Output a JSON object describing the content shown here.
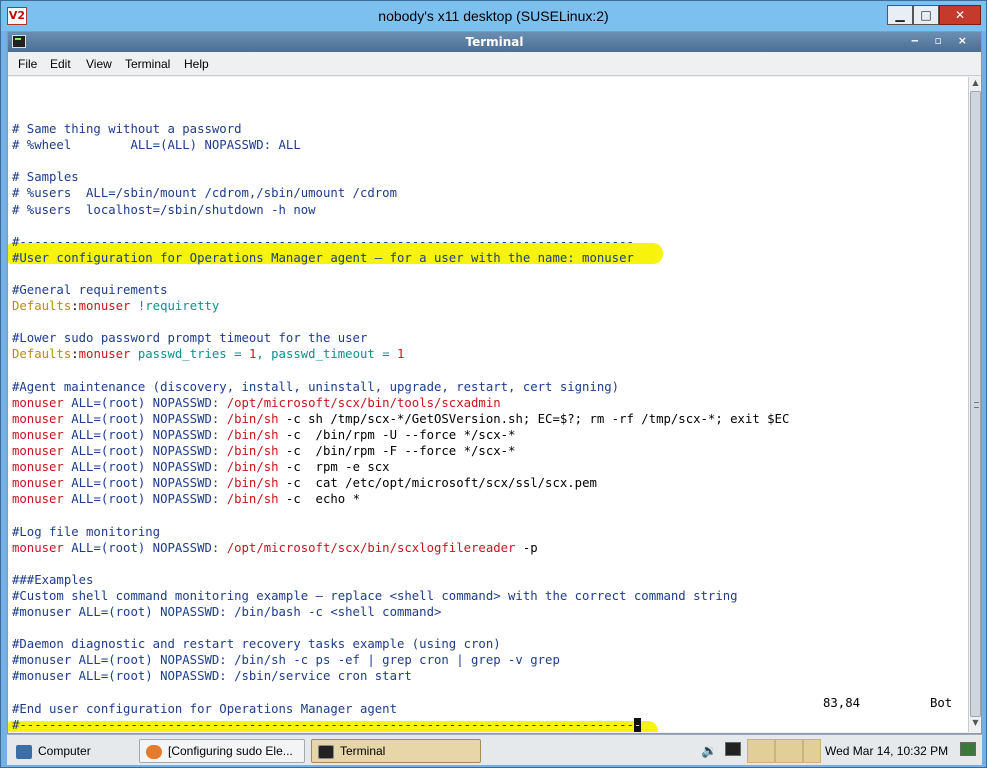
{
  "window": {
    "title": "nobody's x11 desktop (SUSELinux:2)",
    "logo": "V2",
    "minimize": "▁",
    "maximize": "□",
    "close": "✕"
  },
  "terminal": {
    "title": "Terminal",
    "controls": "‒ ▫ ×"
  },
  "menu": [
    "File",
    "Edit",
    "View",
    "Terminal",
    "Help"
  ],
  "colors": {
    "comment": "#1e3c8c",
    "user": "#c8141e",
    "keyword": "#b48c14",
    "value": "#148c8c",
    "number": "#c8141e",
    "path": "#b4148c",
    "plain": "#000000",
    "highlight": "#f7f200"
  },
  "lines": [
    {
      "row": 0,
      "segs": [
        {
          "t": "# Same thing without a password",
          "c": "comment"
        }
      ]
    },
    {
      "row": 1,
      "segs": [
        {
          "t": "# %wheel        ALL=(ALL) NOPASSWD: ALL",
          "c": "comment"
        }
      ]
    },
    {
      "row": 3,
      "segs": [
        {
          "t": "# Samples",
          "c": "comment"
        }
      ]
    },
    {
      "row": 4,
      "segs": [
        {
          "t": "# %users  ALL=/sbin/mount /cdrom,/sbin/umount /cdrom",
          "c": "comment"
        }
      ]
    },
    {
      "row": 5,
      "segs": [
        {
          "t": "# %users  localhost=/sbin/shutdown -h now",
          "c": "comment"
        }
      ]
    },
    {
      "row": 7,
      "segs": [
        {
          "t": "#-----------------------------------------------------------------------------------",
          "c": "comment"
        }
      ]
    },
    {
      "row": 8,
      "segs": [
        {
          "t": "#User configuration for Operations Manager agent – for a user with the name: monuser",
          "c": "comment"
        }
      ]
    },
    {
      "row": 10,
      "segs": [
        {
          "t": "#General requirements",
          "c": "comment"
        }
      ]
    },
    {
      "row": 11,
      "segs": [
        {
          "t": "Defaults",
          "c": "keyword"
        },
        {
          "t": ":",
          "c": "plain"
        },
        {
          "t": "monuser",
          "c": "user"
        },
        {
          "t": " !requiretty",
          "c": "value"
        }
      ]
    },
    {
      "row": 13,
      "segs": [
        {
          "t": "#Lower sudo password prompt timeout for the user",
          "c": "comment"
        }
      ]
    },
    {
      "row": 14,
      "segs": [
        {
          "t": "Defaults",
          "c": "keyword"
        },
        {
          "t": ":",
          "c": "plain"
        },
        {
          "t": "monuser",
          "c": "user"
        },
        {
          "t": " passwd_tries = ",
          "c": "value"
        },
        {
          "t": "1",
          "c": "number"
        },
        {
          "t": ", passwd_timeout = ",
          "c": "value"
        },
        {
          "t": "1",
          "c": "number"
        }
      ]
    },
    {
      "row": 16,
      "segs": [
        {
          "t": "#Agent maintenance (discovery, install, uninstall, upgrade, restart, cert signing)",
          "c": "comment"
        }
      ]
    },
    {
      "row": 17,
      "segs": [
        {
          "t": "monuser",
          "c": "user"
        },
        {
          "t": " ALL=(root) NOPASSWD: ",
          "c": "comment"
        },
        {
          "t": "/opt/microsoft/scx/bin/tools/scxadmin",
          "c": "user"
        }
      ]
    },
    {
      "row": 18,
      "segs": [
        {
          "t": "monuser",
          "c": "user"
        },
        {
          "t": " ALL=(root) NOPASSWD: ",
          "c": "comment"
        },
        {
          "t": "/bin/sh",
          "c": "user"
        },
        {
          "t": " -c sh /tmp/scx-*/GetOSVersion.sh; EC=$?; rm -rf /tmp/scx-*; exit $EC",
          "c": "plain"
        }
      ]
    },
    {
      "row": 19,
      "segs": [
        {
          "t": "monuser",
          "c": "user"
        },
        {
          "t": " ALL=(root) NOPASSWD: ",
          "c": "comment"
        },
        {
          "t": "/bin/sh",
          "c": "user"
        },
        {
          "t": " -c  /bin/rpm -U --force */scx-*",
          "c": "plain"
        }
      ]
    },
    {
      "row": 20,
      "segs": [
        {
          "t": "monuser",
          "c": "user"
        },
        {
          "t": " ALL=(root) NOPASSWD: ",
          "c": "comment"
        },
        {
          "t": "/bin/sh",
          "c": "user"
        },
        {
          "t": " -c  /bin/rpm -F --force */scx-*",
          "c": "plain"
        }
      ]
    },
    {
      "row": 21,
      "segs": [
        {
          "t": "monuser",
          "c": "user"
        },
        {
          "t": " ALL=(root) NOPASSWD: ",
          "c": "comment"
        },
        {
          "t": "/bin/sh",
          "c": "user"
        },
        {
          "t": " -c  rpm -e scx",
          "c": "plain"
        }
      ]
    },
    {
      "row": 22,
      "segs": [
        {
          "t": "monuser",
          "c": "user"
        },
        {
          "t": " ALL=(root) NOPASSWD: ",
          "c": "comment"
        },
        {
          "t": "/bin/sh",
          "c": "user"
        },
        {
          "t": " -c  cat /etc/opt/microsoft/scx/ssl/scx.pem",
          "c": "plain"
        }
      ]
    },
    {
      "row": 23,
      "segs": [
        {
          "t": "monuser",
          "c": "user"
        },
        {
          "t": " ALL=(root) NOPASSWD: ",
          "c": "comment"
        },
        {
          "t": "/bin/sh",
          "c": "user"
        },
        {
          "t": " -c  echo *",
          "c": "plain"
        }
      ]
    },
    {
      "row": 25,
      "segs": [
        {
          "t": "#Log file monitoring",
          "c": "comment"
        }
      ]
    },
    {
      "row": 26,
      "segs": [
        {
          "t": "monuser",
          "c": "user"
        },
        {
          "t": " ALL=(root) NOPASSWD: ",
          "c": "comment"
        },
        {
          "t": "/opt/microsoft/scx/bin/scxlogfilereader",
          "c": "user"
        },
        {
          "t": " -p",
          "c": "plain"
        }
      ]
    },
    {
      "row": 28,
      "segs": [
        {
          "t": "###Examples",
          "c": "comment"
        }
      ]
    },
    {
      "row": 29,
      "segs": [
        {
          "t": "#Custom shell command monitoring example – replace <shell command> with the correct command string",
          "c": "comment"
        }
      ]
    },
    {
      "row": 30,
      "segs": [
        {
          "t": "#monuser ALL=(root) NOPASSWD: /bin/bash -c <shell command>",
          "c": "comment"
        }
      ]
    },
    {
      "row": 32,
      "segs": [
        {
          "t": "#Daemon diagnostic and restart recovery tasks example (using cron)",
          "c": "comment"
        }
      ]
    },
    {
      "row": 33,
      "segs": [
        {
          "t": "#monuser ALL=(root) NOPASSWD: /bin/sh -c ps -ef | grep cron | grep -v grep",
          "c": "comment"
        }
      ]
    },
    {
      "row": 34,
      "segs": [
        {
          "t": "#monuser ALL=(root) NOPASSWD: /sbin/service cron start",
          "c": "comment"
        }
      ]
    },
    {
      "row": 36,
      "segs": [
        {
          "t": "#End user configuration for Operations Manager agent",
          "c": "comment"
        }
      ]
    },
    {
      "row": 37,
      "segs": [
        {
          "t": "#-----------------------------------------------------------------------------------",
          "c": "comment"
        },
        {
          "t": "-",
          "c": "cursor"
        }
      ]
    }
  ],
  "status": {
    "position": "83,84",
    "scroll": "Bot"
  },
  "taskbar": {
    "computer": "Computer",
    "firefox": "[Configuring sudo Ele...",
    "terminal": "Terminal",
    "clock": "Wed Mar 14, 10:32 PM"
  }
}
